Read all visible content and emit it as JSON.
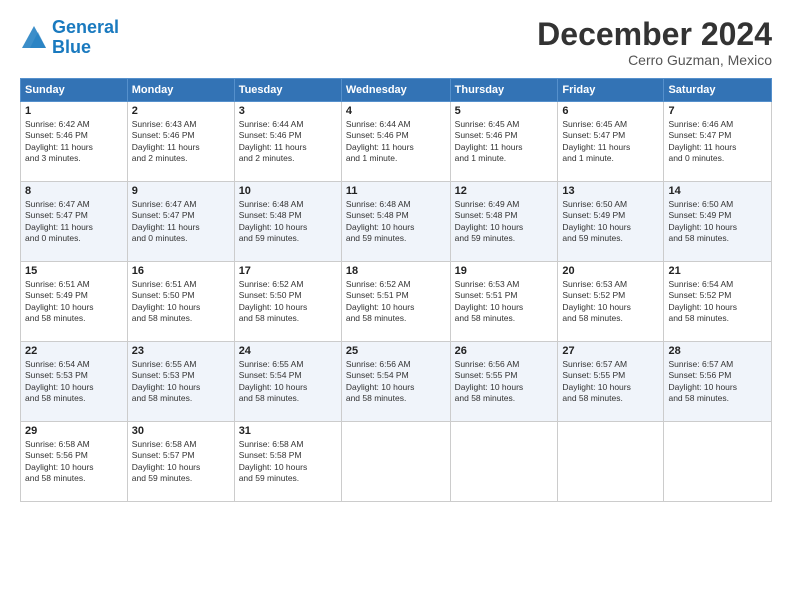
{
  "logo": {
    "line1": "General",
    "line2": "Blue"
  },
  "title": "December 2024",
  "subtitle": "Cerro Guzman, Mexico",
  "days_of_week": [
    "Sunday",
    "Monday",
    "Tuesday",
    "Wednesday",
    "Thursday",
    "Friday",
    "Saturday"
  ],
  "weeks": [
    [
      {
        "day": "1",
        "info": "Sunrise: 6:42 AM\nSunset: 5:46 PM\nDaylight: 11 hours\nand 3 minutes."
      },
      {
        "day": "2",
        "info": "Sunrise: 6:43 AM\nSunset: 5:46 PM\nDaylight: 11 hours\nand 2 minutes."
      },
      {
        "day": "3",
        "info": "Sunrise: 6:44 AM\nSunset: 5:46 PM\nDaylight: 11 hours\nand 2 minutes."
      },
      {
        "day": "4",
        "info": "Sunrise: 6:44 AM\nSunset: 5:46 PM\nDaylight: 11 hours\nand 1 minute."
      },
      {
        "day": "5",
        "info": "Sunrise: 6:45 AM\nSunset: 5:46 PM\nDaylight: 11 hours\nand 1 minute."
      },
      {
        "day": "6",
        "info": "Sunrise: 6:45 AM\nSunset: 5:47 PM\nDaylight: 11 hours\nand 1 minute."
      },
      {
        "day": "7",
        "info": "Sunrise: 6:46 AM\nSunset: 5:47 PM\nDaylight: 11 hours\nand 0 minutes."
      }
    ],
    [
      {
        "day": "8",
        "info": "Sunrise: 6:47 AM\nSunset: 5:47 PM\nDaylight: 11 hours\nand 0 minutes."
      },
      {
        "day": "9",
        "info": "Sunrise: 6:47 AM\nSunset: 5:47 PM\nDaylight: 11 hours\nand 0 minutes."
      },
      {
        "day": "10",
        "info": "Sunrise: 6:48 AM\nSunset: 5:48 PM\nDaylight: 10 hours\nand 59 minutes."
      },
      {
        "day": "11",
        "info": "Sunrise: 6:48 AM\nSunset: 5:48 PM\nDaylight: 10 hours\nand 59 minutes."
      },
      {
        "day": "12",
        "info": "Sunrise: 6:49 AM\nSunset: 5:48 PM\nDaylight: 10 hours\nand 59 minutes."
      },
      {
        "day": "13",
        "info": "Sunrise: 6:50 AM\nSunset: 5:49 PM\nDaylight: 10 hours\nand 59 minutes."
      },
      {
        "day": "14",
        "info": "Sunrise: 6:50 AM\nSunset: 5:49 PM\nDaylight: 10 hours\nand 58 minutes."
      }
    ],
    [
      {
        "day": "15",
        "info": "Sunrise: 6:51 AM\nSunset: 5:49 PM\nDaylight: 10 hours\nand 58 minutes."
      },
      {
        "day": "16",
        "info": "Sunrise: 6:51 AM\nSunset: 5:50 PM\nDaylight: 10 hours\nand 58 minutes."
      },
      {
        "day": "17",
        "info": "Sunrise: 6:52 AM\nSunset: 5:50 PM\nDaylight: 10 hours\nand 58 minutes."
      },
      {
        "day": "18",
        "info": "Sunrise: 6:52 AM\nSunset: 5:51 PM\nDaylight: 10 hours\nand 58 minutes."
      },
      {
        "day": "19",
        "info": "Sunrise: 6:53 AM\nSunset: 5:51 PM\nDaylight: 10 hours\nand 58 minutes."
      },
      {
        "day": "20",
        "info": "Sunrise: 6:53 AM\nSunset: 5:52 PM\nDaylight: 10 hours\nand 58 minutes."
      },
      {
        "day": "21",
        "info": "Sunrise: 6:54 AM\nSunset: 5:52 PM\nDaylight: 10 hours\nand 58 minutes."
      }
    ],
    [
      {
        "day": "22",
        "info": "Sunrise: 6:54 AM\nSunset: 5:53 PM\nDaylight: 10 hours\nand 58 minutes."
      },
      {
        "day": "23",
        "info": "Sunrise: 6:55 AM\nSunset: 5:53 PM\nDaylight: 10 hours\nand 58 minutes."
      },
      {
        "day": "24",
        "info": "Sunrise: 6:55 AM\nSunset: 5:54 PM\nDaylight: 10 hours\nand 58 minutes."
      },
      {
        "day": "25",
        "info": "Sunrise: 6:56 AM\nSunset: 5:54 PM\nDaylight: 10 hours\nand 58 minutes."
      },
      {
        "day": "26",
        "info": "Sunrise: 6:56 AM\nSunset: 5:55 PM\nDaylight: 10 hours\nand 58 minutes."
      },
      {
        "day": "27",
        "info": "Sunrise: 6:57 AM\nSunset: 5:55 PM\nDaylight: 10 hours\nand 58 minutes."
      },
      {
        "day": "28",
        "info": "Sunrise: 6:57 AM\nSunset: 5:56 PM\nDaylight: 10 hours\nand 58 minutes."
      }
    ],
    [
      {
        "day": "29",
        "info": "Sunrise: 6:58 AM\nSunset: 5:56 PM\nDaylight: 10 hours\nand 58 minutes."
      },
      {
        "day": "30",
        "info": "Sunrise: 6:58 AM\nSunset: 5:57 PM\nDaylight: 10 hours\nand 59 minutes."
      },
      {
        "day": "31",
        "info": "Sunrise: 6:58 AM\nSunset: 5:58 PM\nDaylight: 10 hours\nand 59 minutes."
      },
      null,
      null,
      null,
      null
    ]
  ]
}
